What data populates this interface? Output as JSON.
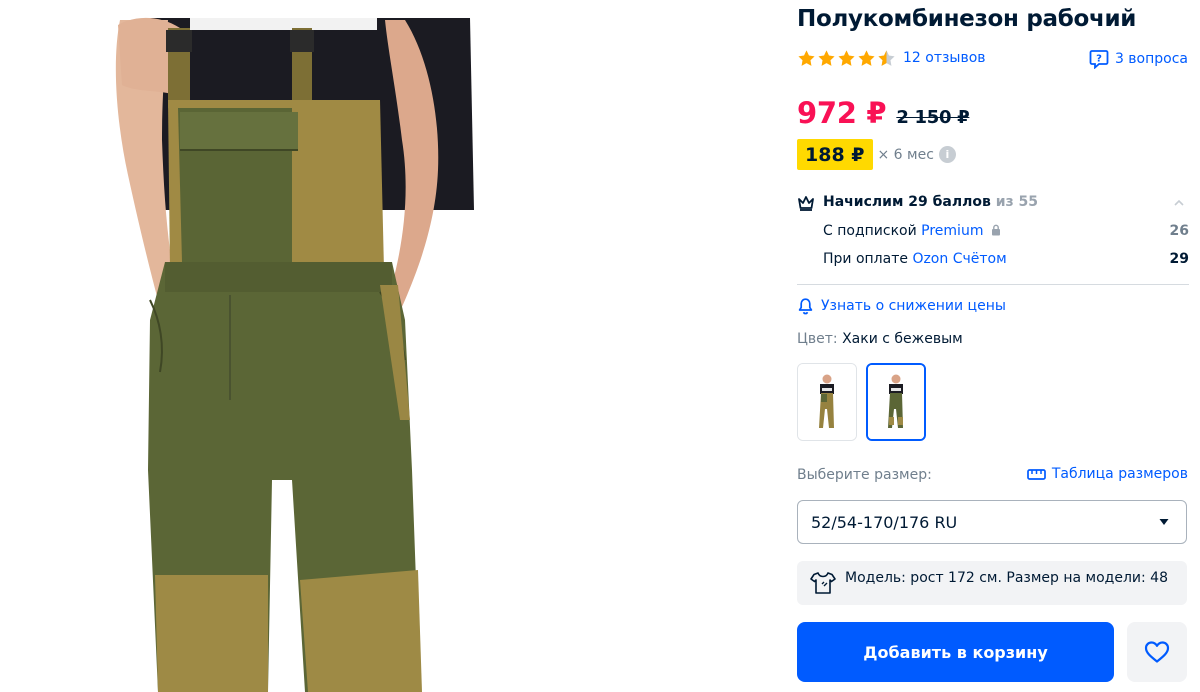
{
  "product": {
    "title": "Полукомбинезон рабочий",
    "image_alt": "product-photo"
  },
  "rating": {
    "stars": 4.5,
    "reviews_label": "12 отзывов",
    "questions_label": "3 вопроса"
  },
  "price": {
    "current": "972 ₽",
    "old": "2 150 ₽",
    "installment": "188 ₽",
    "installment_term": "× 6 мес",
    "info_icon": "i"
  },
  "points": {
    "title": "Начислим 29 баллов",
    "of_label": "из 55",
    "subscription_label": "С подпиской",
    "subscription_link": "Premium",
    "subscription_value": "26",
    "pay_label": "При оплате",
    "pay_link": "Ozon Счётом",
    "pay_value": "29"
  },
  "notify": {
    "label": "Узнать о снижении цены"
  },
  "color": {
    "label": "Цвет:",
    "value": "Хаки с бежевым"
  },
  "size": {
    "label": "Выберите размер:",
    "table_link": "Таблица размеров",
    "selected": "52/54-170/176 RU"
  },
  "model_info": "Модель: рост 172 см. Размер на модели: 48",
  "actions": {
    "add_to_cart": "Добавить в корзину"
  },
  "colors": {
    "accent": "#005bff",
    "price": "#f91155",
    "badge": "#ffd900",
    "star": "#ffa800",
    "khaki": "#5b6636",
    "beige": "#9e8a45"
  }
}
